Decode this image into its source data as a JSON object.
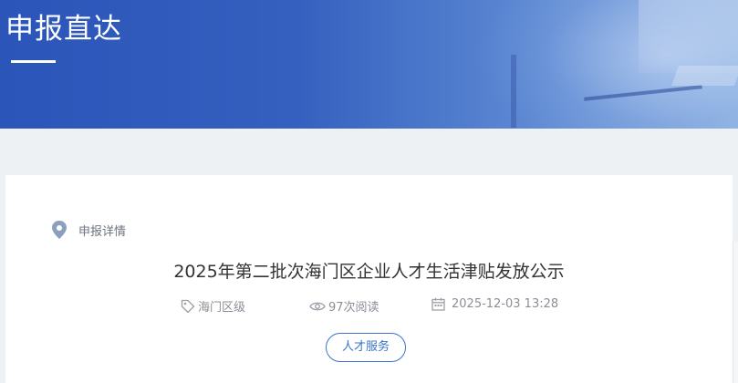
{
  "banner": {
    "title": "申报直达"
  },
  "breadcrumb": {
    "label": "申报详情",
    "icon": "location-pin-icon"
  },
  "article": {
    "title": "2025年第二批次海门区企业人才生活津贴发放公示",
    "meta": {
      "region": "海门区级",
      "views": "97次阅读",
      "date": "2025-12-03 13:28"
    },
    "tag_button": "人才服务"
  },
  "colors": {
    "banner_blue": "#2b55b9",
    "accent": "#3a74cc",
    "page_bg": "#eef1f4"
  }
}
